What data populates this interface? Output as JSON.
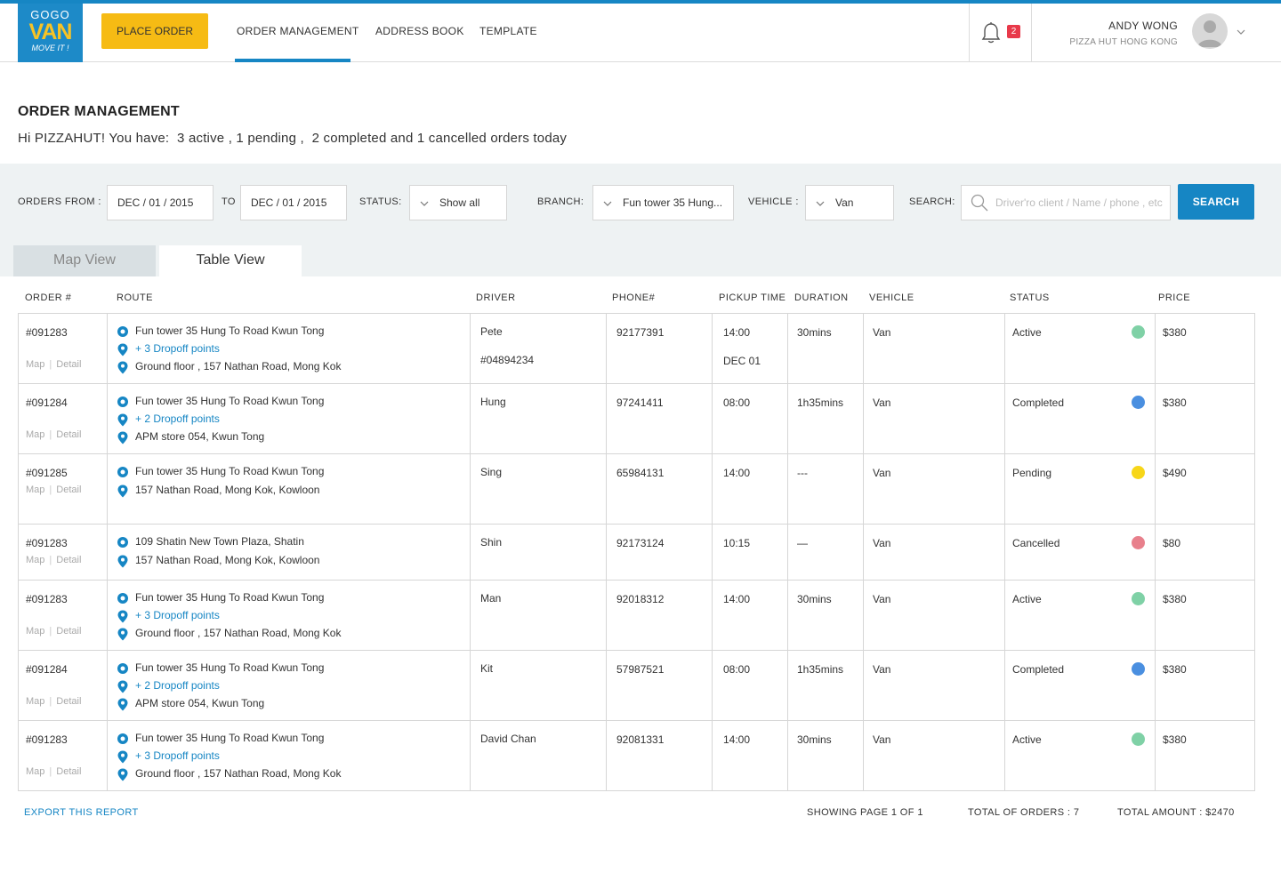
{
  "header": {
    "logo": {
      "line1": "GOGO",
      "line2": "VAN",
      "line3": "MOVE IT !"
    },
    "place_order_label": "PLACE ORDER",
    "nav": [
      "ORDER MANAGEMENT",
      "ADDRESS BOOK",
      "TEMPLATE"
    ],
    "active_nav": "ORDER MANAGEMENT",
    "notification_count": "2",
    "user_name": "ANDY WONG",
    "user_company": "PIZZA HUT HONG KONG",
    "accent_color": "#1686c4"
  },
  "page": {
    "title": "ORDER MANAGEMENT",
    "greeting": "Hi PIZZAHUT! You have:  3 active , 1 pending ,  2 completed and 1 cancelled orders today"
  },
  "filters": {
    "orders_from_label": "ORDERS FROM :",
    "from_date": "DEC / 01 / 2015",
    "to_label": "TO",
    "to_date": "DEC / 01 / 2015",
    "status_label": "STATUS:",
    "status_value": "Show all",
    "branch_label": "BRANCH:",
    "branch_value": "Fun tower 35 Hung...",
    "vehicle_label": "VEHICLE :",
    "vehicle_value": "Van",
    "search_label": "SEARCH:",
    "search_placeholder": "Driver'ro client / Name / phone , etc",
    "search_button": "SEARCH"
  },
  "tabs": [
    "Map View",
    "Table View"
  ],
  "table": {
    "headers": [
      "ORDER #",
      "ROUTE",
      "DRIVER",
      "PHONE#",
      "PICKUP TIME",
      "DURATION",
      "VEHICLE",
      "STATUS",
      "PRICE"
    ],
    "map_link": "Map",
    "detail_link": "Detail",
    "rows": [
      {
        "order": "#091283",
        "route": [
          "Fun tower 35 Hung To Road Kwun Tong",
          "+ 3 Dropoff points",
          "Ground floor , 157 Nathan Road, Mong Kok"
        ],
        "driver": "Pete",
        "driver_id": "#04894234",
        "phone": "92177391",
        "pickup": "14:00",
        "pickup_date": "DEC 01",
        "duration": "30mins",
        "vehicle": "Van",
        "status": "Active",
        "status_color": "#7fd1a6",
        "price": "$380"
      },
      {
        "order": "#091284",
        "route": [
          "Fun tower 35 Hung To Road Kwun Tong",
          "+ 2 Dropoff points",
          "APM store 054, Kwun Tong"
        ],
        "driver": "Hung",
        "phone": "97241411",
        "pickup": "08:00",
        "duration": "1h35mins",
        "vehicle": "Van",
        "status": "Completed",
        "status_color": "#4a8fe0",
        "price": "$380"
      },
      {
        "order": "#091285",
        "route": [
          "Fun tower 35 Hung To Road Kwun Tong",
          "157 Nathan Road, Mong Kok, Kowloon"
        ],
        "driver": "Sing",
        "phone": "65984131",
        "pickup": "14:00",
        "duration": "---",
        "vehicle": "Van",
        "status": "Pending",
        "status_color": "#f7d619",
        "price": "$490"
      },
      {
        "order": "#091283",
        "route": [
          "109 Shatin New Town Plaza, Shatin",
          "157 Nathan Road, Mong Kok, Kowloon"
        ],
        "driver": "Shin",
        "phone": "92173124",
        "pickup": "10:15",
        "duration": "—",
        "vehicle": "Van",
        "status": "Cancelled",
        "status_color": "#e8808c",
        "price": "$80"
      },
      {
        "order": "#091283",
        "route": [
          "Fun tower 35 Hung To Road Kwun Tong",
          "+ 3 Dropoff points",
          "Ground floor , 157 Nathan Road, Mong Kok"
        ],
        "driver": "Man",
        "phone": "92018312",
        "pickup": "14:00",
        "duration": "30mins",
        "vehicle": "Van",
        "status": "Active",
        "status_color": "#7fd1a6",
        "price": "$380"
      },
      {
        "order": "#091284",
        "route": [
          "Fun tower 35 Hung To Road Kwun Tong",
          "+ 2 Dropoff points",
          "APM store 054, Kwun Tong"
        ],
        "driver": "Kit",
        "phone": "57987521",
        "pickup": "08:00",
        "duration": "1h35mins",
        "vehicle": "Van",
        "status": "Completed",
        "status_color": "#4a8fe0",
        "price": "$380"
      },
      {
        "order": "#091283",
        "route": [
          "Fun tower 35 Hung To Road Kwun Tong",
          "+ 3 Dropoff points",
          "Ground floor , 157 Nathan Road, Mong Kok"
        ],
        "driver": "David Chan",
        "phone": "92081331",
        "pickup": "14:00",
        "duration": "30mins",
        "vehicle": "Van",
        "status": "Active",
        "status_color": "#7fd1a6",
        "price": "$380"
      }
    ]
  },
  "footer": {
    "export_label": "EXPORT THIS REPORT",
    "page_info": "SHOWING PAGE 1 OF 1",
    "total_orders": "TOTAL OF ORDERS : 7",
    "total_amount": "TOTAL AMOUNT : $2470"
  }
}
